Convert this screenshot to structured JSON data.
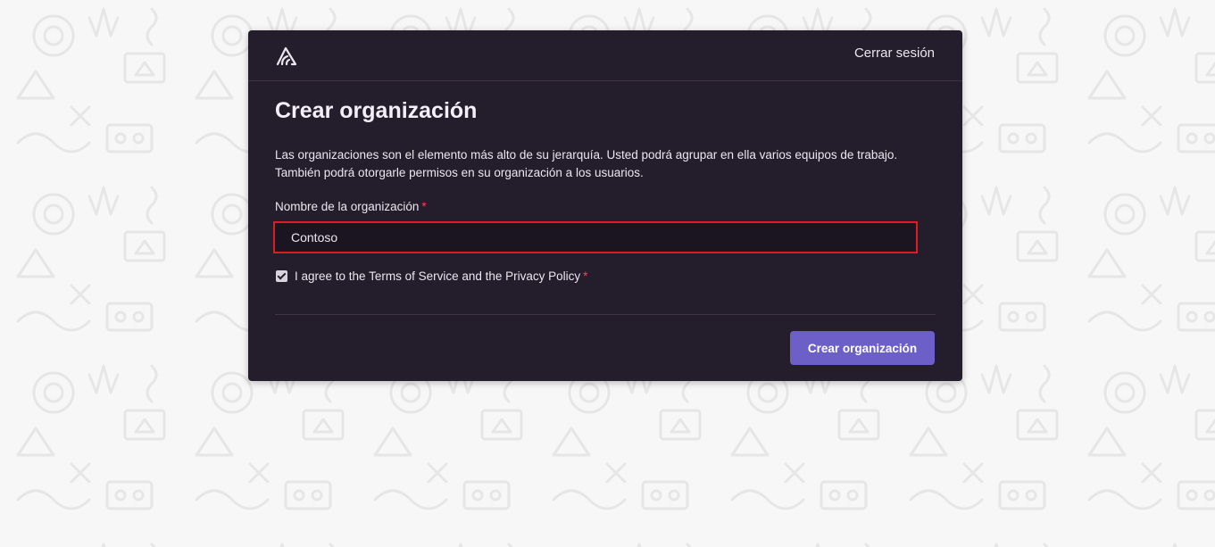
{
  "header": {
    "logo_icon": "sentry-logo-icon",
    "logout_label": "Cerrar sesión"
  },
  "main": {
    "title": "Crear organización",
    "description": "Las organizaciones son el elemento más alto de su jerarquía. Usted podrá agrupar en ella varios equipos de trabajo. También podrá otorgarle permisos en su organización a los usuarios.",
    "org_name_label": "Nombre de la organización",
    "required_marker": "*",
    "org_name_value": "Contoso",
    "agree_label": "I agree to the Terms of Service and the Privacy Policy",
    "agree_checked": true,
    "submit_label": "Crear organización"
  },
  "colors": {
    "card_background": "#241e2c",
    "accent": "#6c5fc7",
    "required": "#e94b54",
    "highlight_border": "#e01b24"
  }
}
